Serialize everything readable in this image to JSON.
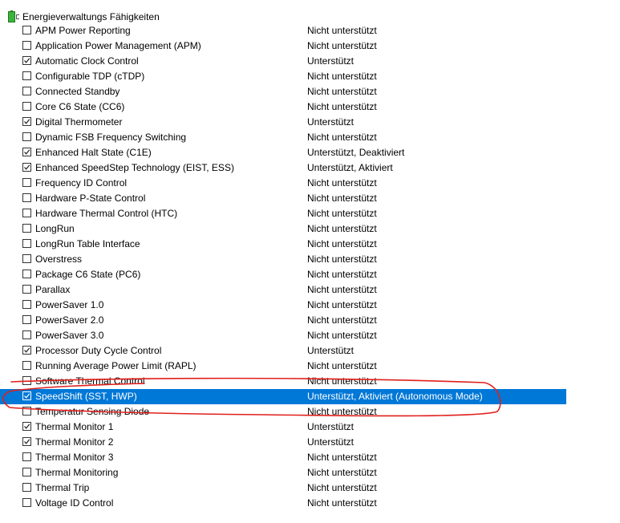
{
  "header": {
    "label": "Energieverwaltungs Fähigkeiten",
    "icon": "battery-plug-icon"
  },
  "colors": {
    "selection": "#0078d7",
    "annotation": "#e0201c"
  },
  "features": [
    {
      "name": "APM Power Reporting",
      "status": "Nicht unterstützt",
      "checked": false
    },
    {
      "name": "Application Power Management (APM)",
      "status": "Nicht unterstützt",
      "checked": false
    },
    {
      "name": "Automatic Clock Control",
      "status": "Unterstützt",
      "checked": true
    },
    {
      "name": "Configurable TDP (cTDP)",
      "status": "Nicht unterstützt",
      "checked": false
    },
    {
      "name": "Connected Standby",
      "status": "Nicht unterstützt",
      "checked": false
    },
    {
      "name": "Core C6 State (CC6)",
      "status": "Nicht unterstützt",
      "checked": false
    },
    {
      "name": "Digital Thermometer",
      "status": "Unterstützt",
      "checked": true
    },
    {
      "name": "Dynamic FSB Frequency Switching",
      "status": "Nicht unterstützt",
      "checked": false
    },
    {
      "name": "Enhanced Halt State (C1E)",
      "status": "Unterstützt, Deaktiviert",
      "checked": true
    },
    {
      "name": "Enhanced SpeedStep Technology (EIST, ESS)",
      "status": "Unterstützt, Aktiviert",
      "checked": true
    },
    {
      "name": "Frequency ID Control",
      "status": "Nicht unterstützt",
      "checked": false
    },
    {
      "name": "Hardware P-State Control",
      "status": "Nicht unterstützt",
      "checked": false
    },
    {
      "name": "Hardware Thermal Control (HTC)",
      "status": "Nicht unterstützt",
      "checked": false
    },
    {
      "name": "LongRun",
      "status": "Nicht unterstützt",
      "checked": false
    },
    {
      "name": "LongRun Table Interface",
      "status": "Nicht unterstützt",
      "checked": false
    },
    {
      "name": "Overstress",
      "status": "Nicht unterstützt",
      "checked": false
    },
    {
      "name": "Package C6 State (PC6)",
      "status": "Nicht unterstützt",
      "checked": false
    },
    {
      "name": "Parallax",
      "status": "Nicht unterstützt",
      "checked": false
    },
    {
      "name": "PowerSaver 1.0",
      "status": "Nicht unterstützt",
      "checked": false
    },
    {
      "name": "PowerSaver 2.0",
      "status": "Nicht unterstützt",
      "checked": false
    },
    {
      "name": "PowerSaver 3.0",
      "status": "Nicht unterstützt",
      "checked": false
    },
    {
      "name": "Processor Duty Cycle Control",
      "status": "Unterstützt",
      "checked": true
    },
    {
      "name": "Running Average Power Limit (RAPL)",
      "status": "Nicht unterstützt",
      "checked": false
    },
    {
      "name": "Software Thermal Control",
      "status": "Nicht unterstützt",
      "checked": false
    },
    {
      "name": "SpeedShift (SST, HWP)",
      "status": "Unterstützt, Aktiviert (Autonomous Mode)",
      "checked": true,
      "selected": true
    },
    {
      "name": "Temperatur Sensing Diode",
      "status": "Nicht unterstützt",
      "checked": false
    },
    {
      "name": "Thermal Monitor 1",
      "status": "Unterstützt",
      "checked": true
    },
    {
      "name": "Thermal Monitor 2",
      "status": "Unterstützt",
      "checked": true
    },
    {
      "name": "Thermal Monitor 3",
      "status": "Nicht unterstützt",
      "checked": false
    },
    {
      "name": "Thermal Monitoring",
      "status": "Nicht unterstützt",
      "checked": false
    },
    {
      "name": "Thermal Trip",
      "status": "Nicht unterstützt",
      "checked": false
    },
    {
      "name": "Voltage ID Control",
      "status": "Nicht unterstützt",
      "checked": false
    }
  ]
}
